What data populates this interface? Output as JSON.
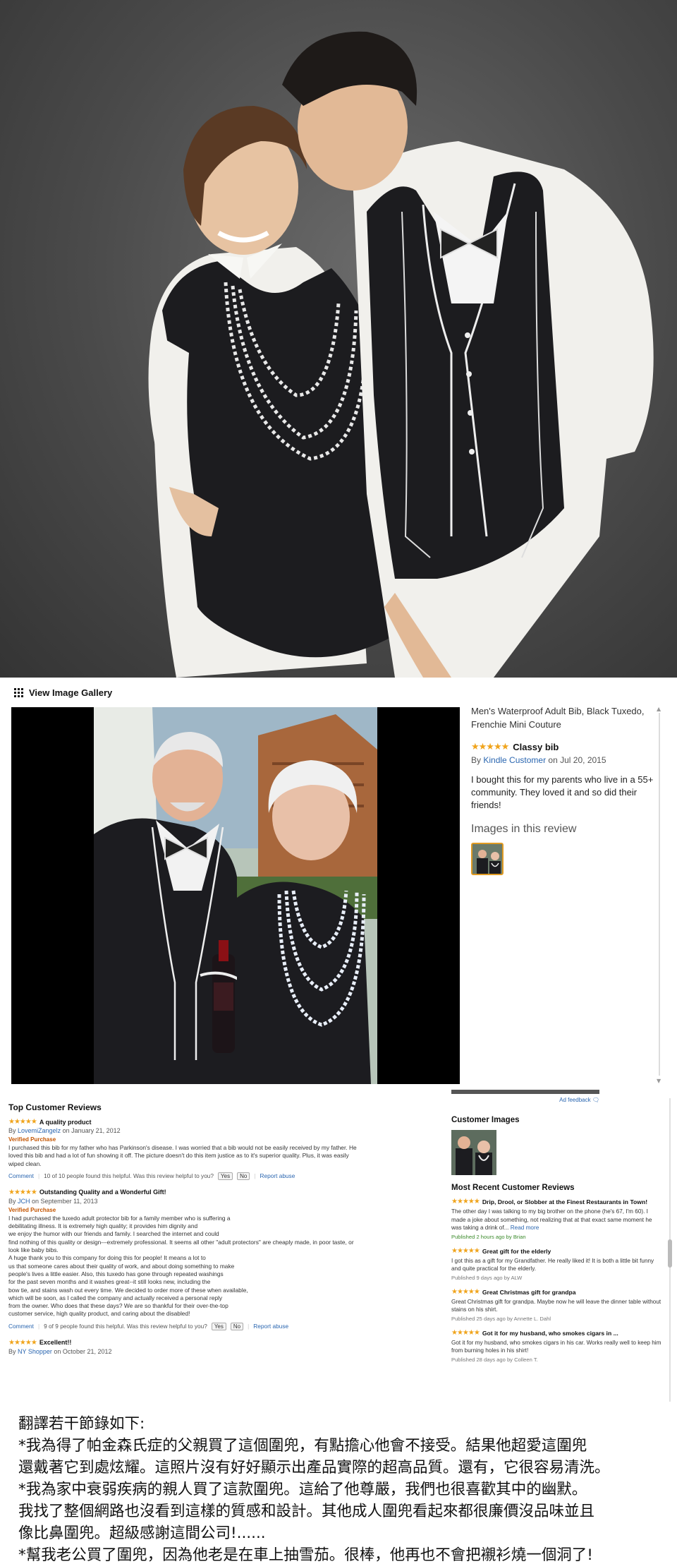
{
  "gallery": {
    "header_label": "View Image Gallery",
    "product_title": "Men's Waterproof Adult Bib, Black Tuxedo, Frenchie Mini Couture",
    "review": {
      "stars": "★★★★★",
      "title": "Classy bib",
      "by_prefix": "By",
      "author": "Kindle Customer",
      "date_prefix": "on",
      "date": "Jul 20, 2015",
      "body": "I bought this for my parents who live in a 55+ community. They loved it and so did their friends!"
    },
    "images_heading": "Images in this review"
  },
  "reviews": {
    "heading": "Top Customer Reviews",
    "items": [
      {
        "stars": "★★★★★",
        "title": "A quality product",
        "by_prefix": "By",
        "author": "LovemiZangelz",
        "date": "on January 21, 2012",
        "verified": "Verified Purchase",
        "body": "I purchased this bib for my father who has Parkinson's disease. I was worried that a bib would not be easily received by my father. He\nloved this bib and had a lot of fun showing it off. The picture doesn't do this item justice as to it's superior quality. Plus, it was easily\nwiped clean.",
        "comment": "Comment",
        "helpful": "10 of 10 people found this helpful. Was this review helpful to you?",
        "yes": "Yes",
        "no": "No",
        "report": "Report abuse"
      },
      {
        "stars": "★★★★★",
        "title": "Outstanding Quality and a Wonderful Gift!",
        "by_prefix": "By",
        "author": "JCH",
        "date": "on September 11, 2013",
        "verified": "Verified Purchase",
        "body": "I had purchased the tuxedo adult protector bib for a family member who is suffering a\ndebilitating illness. It is extremely high quality; it provides him dignity and\nwe enjoy the humor with our friends and family. I searched the internet and could\nfind nothing of this quality or design---extremely professional. It seems all other \"adult protectors\" are cheaply made, in poor taste, or\nlook like baby bibs.\nA huge thank you to this company for doing this for people! It means a lot to\nus that someone cares about their quality of work, and about doing something to make\npeople's lives a little easier. Also, this tuxedo has gone through repeated washings\nfor the past seven months and it washes great--it still looks new, including the\nbow tie, and stains wash out every time. We decided to order more of these when available,\nwhich will be soon, as I called the company and actually received a personal reply\nfrom the owner. Who does that these days? We are so thankful for their over-the-top\ncustomer service, high quality product, and caring about the disabled!",
        "comment": "Comment",
        "helpful": "9 of 9 people found this helpful. Was this review helpful to you?",
        "yes": "Yes",
        "no": "No",
        "report": "Report abuse"
      },
      {
        "stars": "★★★★★",
        "title": "Excellent!!",
        "by_prefix": "By",
        "author": "NY Shopper",
        "date": "on October 21, 2012"
      }
    ],
    "ad_feedback": "Ad feedback",
    "customer_images_heading": "Customer Images",
    "most_recent_heading": "Most Recent Customer Reviews",
    "recent": [
      {
        "stars": "★★★★★",
        "title": "Drip, Drool, or Slobber at the Finest Restaurants in Town!",
        "body": "The other day I was talking to my big brother on the phone (he's 67, I'm 60). I made a joke about something, not realizing that at that exact same moment he was taking a drink of...",
        "read_more": "Read more",
        "meta_prefix": "Published 2 hours ago by",
        "author": "Brian"
      },
      {
        "stars": "★★★★★",
        "title": "Great gift for the elderly",
        "body": "I got this as a gift for my Grandfather. He really liked it! It is both a little bit funny and quite practical for the elderly.",
        "meta_prefix": "Published 9 days ago by",
        "author": "ALW"
      },
      {
        "stars": "★★★★★",
        "title": "Great Christmas gift for grandpa",
        "body": "Great Christmas gift for grandpa. Maybe now he will leave the dinner table without stains on his shirt.",
        "meta_prefix": "Published 25 days ago by",
        "author": "Annette L. Dahl"
      },
      {
        "stars": "★★★★★",
        "title": "Got it for my husband, who smokes cigars in ...",
        "body": "Got it for my husband, who smokes cigars in his car. Works really well to keep him from burning holes in his shirt!",
        "meta_prefix": "Published 28 days ago by",
        "author": "Colleen T."
      }
    ]
  },
  "caption": {
    "lines": [
      "翻譯若干節錄如下:",
      "*我為得了帕金森氏症的父親買了這個圍兜，有點擔心他會不接受。結果他超愛這圍兜",
      "還戴著它到處炫耀。這照片沒有好好顯示出產品實際的超高品質。還有，它很容易清洗。",
      "*我為家中衰弱疾病的親人買了這款圍兜。這給了他尊嚴，我們也很喜歡其中的幽默。",
      "我找了整個網路也沒看到這樣的質感和設計。其他成人圍兜看起來都很廉價沒品味並且",
      "像比鼻圍兜。超級感謝這間公司!......",
      "*幫我老公買了圍兜，因為他老是在車上抽雪茄。很棒，他再也不會把襯衫燒一個洞了!"
    ]
  },
  "icons": {
    "gallery": "grid-icon",
    "ad_feedback": "feedback-icon"
  },
  "colors": {
    "star": "#f0a41c",
    "link": "#2a66b0",
    "verified": "#c45500",
    "thumb_border": "#e09b23"
  }
}
